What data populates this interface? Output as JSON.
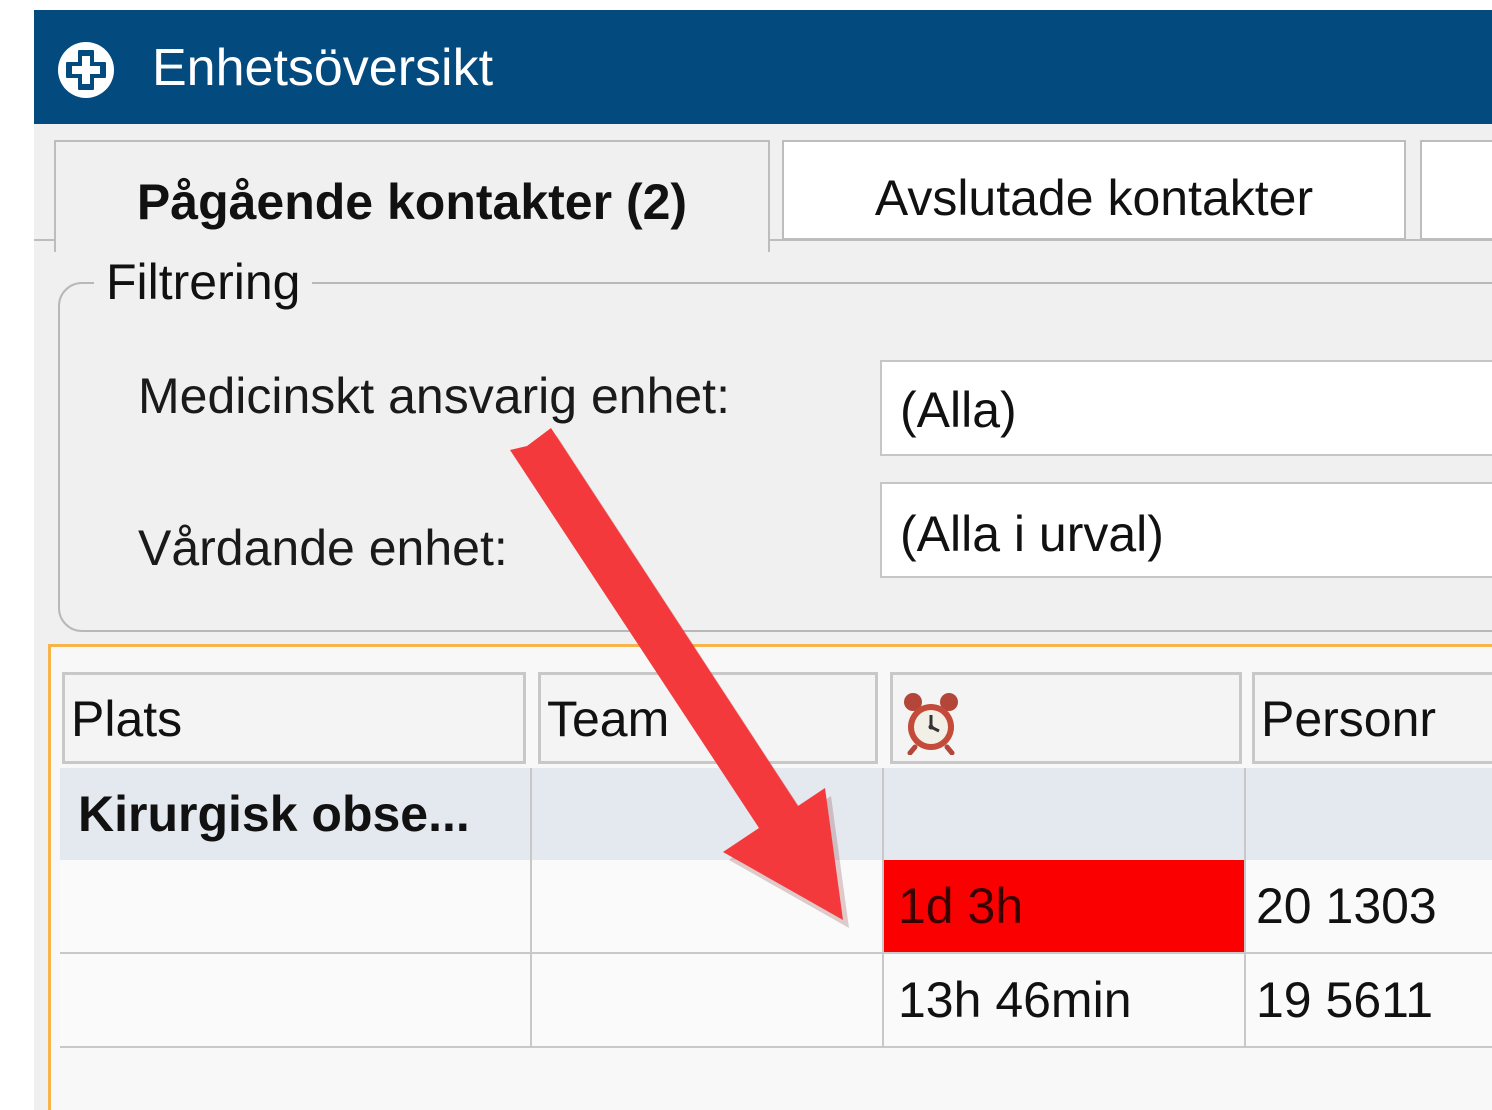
{
  "window": {
    "title": "Enhetsöversikt",
    "title_icon": "medical-cross-icon",
    "titlebar_color": "#034a7f"
  },
  "tabs": [
    {
      "label": "Pågående kontakter (2)",
      "active": true
    },
    {
      "label": "Avslutade kontakter",
      "active": false
    },
    {
      "label": "",
      "active": false
    }
  ],
  "filter": {
    "legend": "Filtrering",
    "medical_unit": {
      "label": "Medicinskt ansvarig enhet:",
      "value": "(Alla)"
    },
    "care_unit": {
      "label": "Vårdande enhet:",
      "value": "(Alla i urval)"
    }
  },
  "grid": {
    "columns": [
      "Plats",
      "Team",
      "",
      "Personr"
    ],
    "time_column_icon": "alarm-clock-icon",
    "group": {
      "label": "Kirurgisk obse..."
    },
    "rows": [
      {
        "plats": "",
        "team": "",
        "time": "1d 3h",
        "personnr": "20 1303",
        "alert": true
      },
      {
        "plats": "",
        "team": "",
        "time": "13h 46min",
        "personnr": "19 5611",
        "alert": false
      }
    ],
    "alert_color": "#fb0000",
    "panel_border_color": "#f6b44a"
  },
  "annotation": {
    "type": "arrow-icon",
    "color": "#f4393d"
  }
}
